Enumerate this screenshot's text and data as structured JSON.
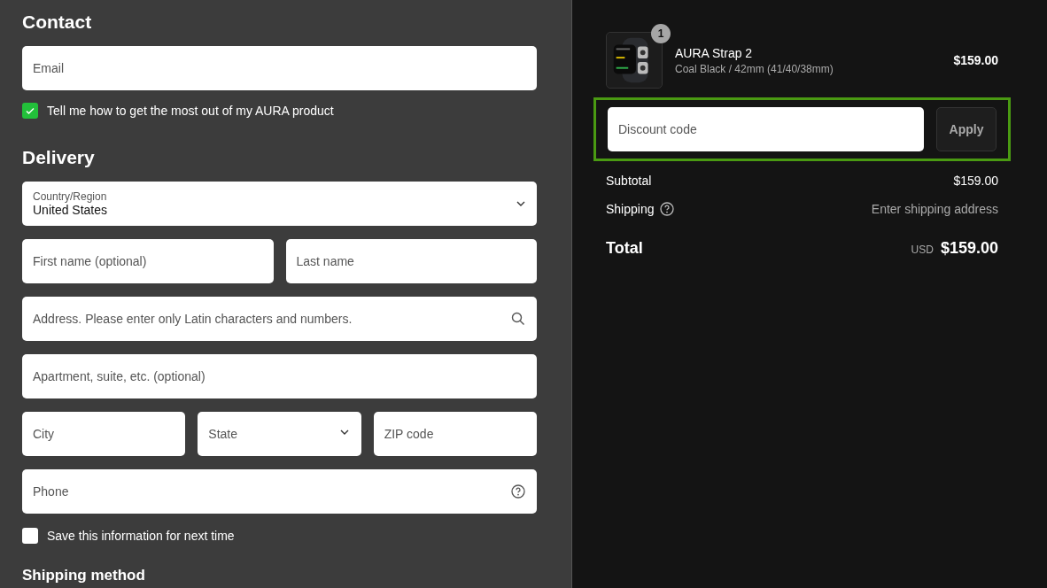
{
  "contact": {
    "heading": "Contact",
    "email": {
      "placeholder": "Email"
    },
    "newsletter": {
      "label": "Tell me how to get the most out of my AURA product",
      "checked": true
    }
  },
  "delivery": {
    "heading": "Delivery",
    "rows": [
      [
        {
          "kind": "select",
          "label": "Country/Region",
          "value": "United States"
        }
      ],
      [
        {
          "kind": "text",
          "placeholder": "First name (optional)"
        },
        {
          "kind": "text",
          "placeholder": "Last name"
        }
      ],
      [
        {
          "kind": "search",
          "placeholder": "Address. Please enter only Latin characters and numbers."
        }
      ],
      [
        {
          "kind": "text",
          "placeholder": "Apartment, suite, etc. (optional)"
        }
      ],
      [
        {
          "kind": "text",
          "placeholder": "City"
        },
        {
          "kind": "dropdown",
          "placeholder": "State"
        },
        {
          "kind": "text",
          "placeholder": "ZIP code"
        }
      ],
      [
        {
          "kind": "help",
          "placeholder": "Phone"
        }
      ]
    ],
    "save": {
      "label": "Save this information for next time",
      "checked": false
    }
  },
  "shipping_method": {
    "heading": "Shipping method"
  },
  "summary": {
    "item": {
      "quantity": "1",
      "name": "AURA Strap 2",
      "variant": "Coal Black / 42mm (41/40/38mm)",
      "price": "$159.00"
    },
    "discount": {
      "placeholder": "Discount code",
      "button": "Apply"
    },
    "subtotal": {
      "label": "Subtotal",
      "value": "$159.00"
    },
    "shipping": {
      "label": "Shipping",
      "value": "Enter shipping address"
    },
    "total": {
      "label": "Total",
      "currency": "USD",
      "value": "$159.00"
    }
  }
}
